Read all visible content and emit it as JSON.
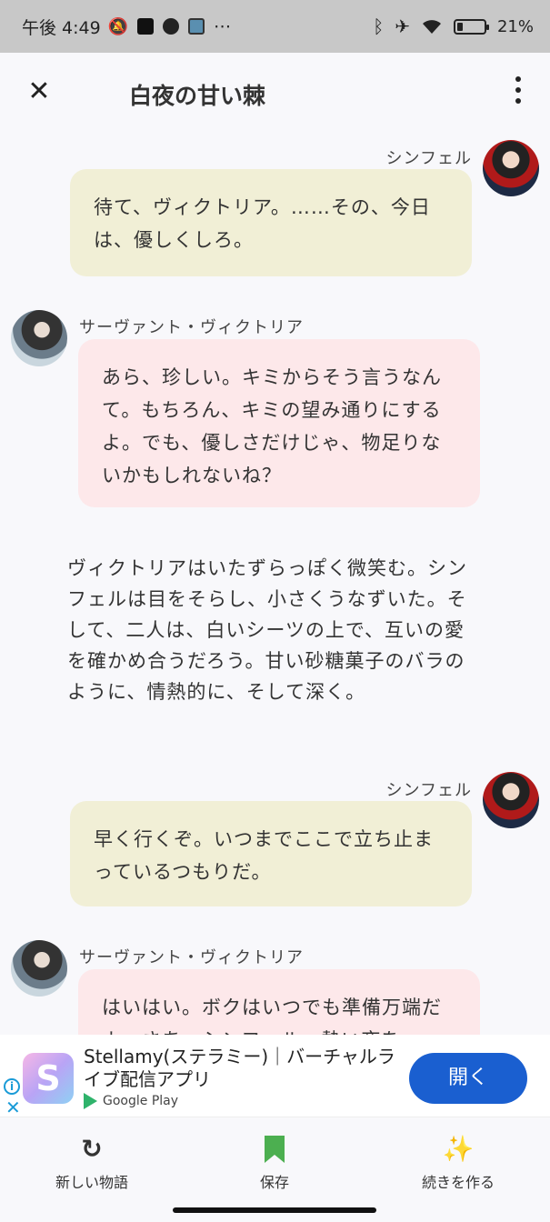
{
  "status_bar": {
    "time": "午後 4:49",
    "battery": "21%",
    "battery_level": 0.21,
    "more_icon": "⋯"
  },
  "header": {
    "title": "白夜の甘い棘",
    "close_icon": "✕"
  },
  "messages": [
    {
      "speaker": "シンフェル",
      "text": "待て、ヴィクトリア。……その、今日は、優しくしろ。"
    },
    {
      "speaker": "サーヴァント・ヴィクトリア",
      "text": "あら、珍しい。キミからそう言うなんて。もちろん、キミの望み通りにするよ。でも、優しさだけじゃ、物足りないかもしれないね？"
    },
    {
      "narration": "ヴィクトリアはいたずらっぽく微笑む。シンフェルは目をそらし、小さくうなずいた。そして、二人は、白いシーツの上で、互いの愛を確かめ合うだろう。甘い砂糖菓子のバラのように、情熱的に、そして深く。"
    },
    {
      "speaker": "シンフェル",
      "text": "早く行くぞ。いつまでここで立ち止まっているつもりだ。"
    },
    {
      "speaker": "サーヴァント・ヴィクトリア",
      "text": "はいはい。ボクはいつでも準備万端だよ。さあ、シンフェル。熱い夜を"
    }
  ],
  "ad": {
    "logo_letter": "S",
    "title": "Stellamy(ステラミー)｜バーチャルライブ配信アプリ",
    "store": "Google Play",
    "button": "開く",
    "info_icon": "i",
    "close_icon": "✕"
  },
  "bottom_nav": {
    "new_story": "新しい物語",
    "save": "保存",
    "continue": "続きを作る",
    "refresh_icon": "↻",
    "sparkle_icon": "✨"
  }
}
